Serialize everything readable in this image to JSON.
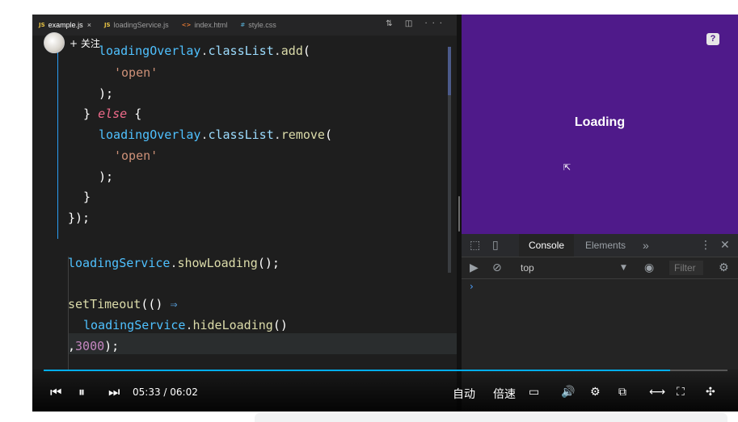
{
  "editor": {
    "tabs": [
      {
        "icon": "JS",
        "label": "example.js",
        "active": true,
        "close": "×"
      },
      {
        "icon": "JS",
        "label": "loadingService.js"
      },
      {
        "icon": "<>",
        "label": "index.html"
      },
      {
        "icon": "#",
        "label": "style.css"
      }
    ],
    "tab_actions": "⇅ ◫ ···",
    "follow_label": "+ 关注",
    "code": {
      "l1": [
        "loadingOverlay",
        ".",
        "classList",
        ".",
        "add",
        "("
      ],
      "l2": [
        "'open'"
      ],
      "l3": [
        ");"
      ],
      "l4": [
        "} ",
        "else",
        " {"
      ],
      "l5": [
        "loadingOverlay",
        ".",
        "classList",
        ".",
        "remove",
        "("
      ],
      "l6": [
        "'open'"
      ],
      "l7": [
        ");"
      ],
      "l8": [
        "}"
      ],
      "l9": [
        "});"
      ],
      "l10": [
        "loadingService",
        ".",
        "showLoading",
        "();"
      ],
      "l11": [
        "setTimeout",
        "(() ",
        "⇒"
      ],
      "l12": [
        "loadingService",
        ".",
        "hideLoading",
        "()"
      ],
      "l13": [
        ",",
        "3000",
        ");"
      ]
    }
  },
  "preview": {
    "text": "Loading",
    "help": "?",
    "background": "#4f1a8a"
  },
  "devtools": {
    "tabs": [
      "Console",
      "Elements",
      "»"
    ],
    "context": "top",
    "filter_placeholder": "Filter",
    "prompt": "›"
  },
  "player": {
    "time": "05:33 / 06:02",
    "progress": 0.916,
    "auto_label": "自动",
    "speed_label": "倍速",
    "accent": "#00aeec"
  }
}
